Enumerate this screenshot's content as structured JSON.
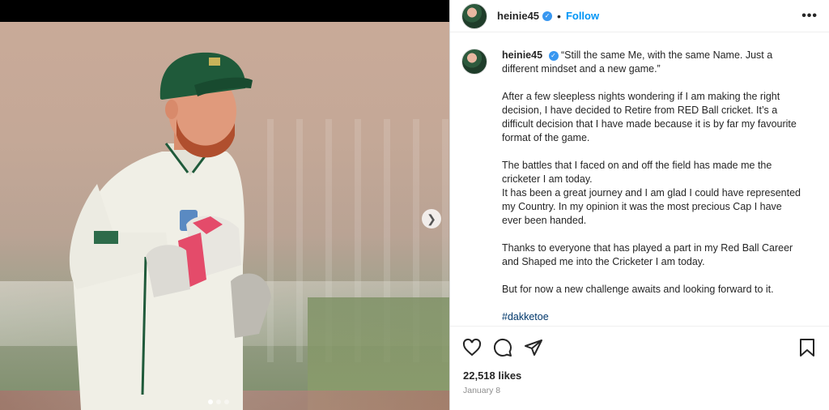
{
  "account": {
    "username": "heinie45",
    "follow_label": "Follow",
    "separator": "•"
  },
  "caption": {
    "username": "heinie45",
    "paragraphs": [
      "“Still the same Me, with the same Name. Just a different mindset and a new game.”",
      "After a few sleepless nights wondering if I am making the right decision, I have decided to Retire from RED Ball cricket. It’s a difficult decision that I have made because it is by far my favourite format of the game.",
      "The battles that I faced on and off the field has made me the cricketer I am today.",
      "It has been a great journey and I am glad I could have represented my Country. In my opinion it was the most precious Cap I have ever been handed.",
      "Thanks to everyone that has played a part in my Red Ball Career and Shaped me into the Cricketer I am today.",
      "But for now a new challenge awaits and looking forward to it."
    ],
    "hashtag": "#dakketoe"
  },
  "stats": {
    "likes": "22,518 likes",
    "date": "January 8"
  },
  "carousel": {
    "slide_count": 3,
    "active_slide": 1
  },
  "icons": {
    "verified": "verified-badge-icon",
    "more": "more-options-icon",
    "like": "heart-icon",
    "comment": "comment-icon",
    "share": "paper-plane-icon",
    "save": "bookmark-icon",
    "next": "chevron-right-icon"
  },
  "colors": {
    "follow_blue": "#0095f6",
    "verified_blue": "#3897f0",
    "hashtag": "#00376b",
    "cap_green": "#1f5a3a"
  }
}
